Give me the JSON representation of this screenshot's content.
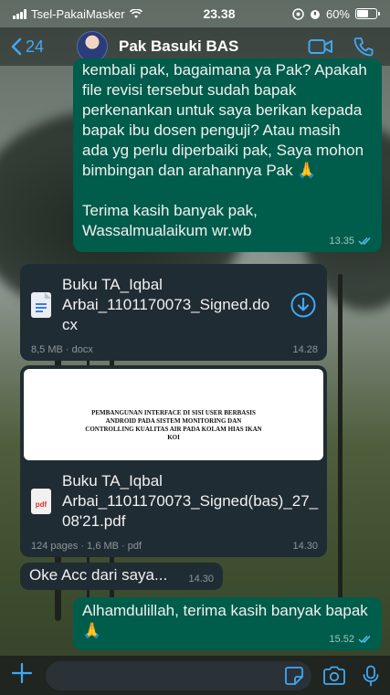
{
  "status_bar": {
    "carrier": "Tsel-PakaiMasker",
    "time": "23.38",
    "battery": "60%",
    "battery_level": 0.6
  },
  "header": {
    "back_count": "24",
    "contact_name": "Pak Basuki BAS",
    "icons": [
      "chevron-left-icon",
      "video-camera-icon",
      "phone-icon"
    ]
  },
  "messages": [
    {
      "direction": "outgoing",
      "lines": [
        "kembali pak, bagaimana ya Pak? Apakah",
        "file revisi tersebut sudah bapak",
        "perkenankan untuk saya berikan kepada",
        "bapak ibu dosen penguji? Atau masih",
        "ada yg perlu diperbaiki pak, Saya mohon",
        "bimbingan dan arahannya Pak 🙏",
        "",
        "Terima kasih banyak pak,",
        "Wassalmualaikum wr.wb"
      ],
      "time": "13.35"
    },
    {
      "direction": "incoming",
      "type": "document",
      "file_name_lines": [
        "Buku TA_Iqbal",
        "Arbai_1101170073_Signed.do",
        "cx"
      ],
      "info": "8,5 MB · docx",
      "time": "14.28"
    },
    {
      "direction": "incoming",
      "type": "pdf",
      "preview_lines": [
        "PEMBANGUNAN INTERFACE DI SISI USER BERBASIS",
        "ANDROID PADA SISTEM MONITORING DAN",
        "CONTROLLING KUALITAS AIR PADA KOLAM HIAS IKAN",
        "KOI"
      ],
      "file_name_lines": [
        "Buku TA_Iqbal",
        "Arbai_1101170073_Signed(bas)_27_",
        "08'21.pdf"
      ],
      "icon_label": "pdf",
      "info": "124 pages · 1,6 MB · pdf",
      "time": "14.30"
    },
    {
      "direction": "incoming",
      "text": "Oke Acc dari saya...",
      "time": "14.30"
    },
    {
      "direction": "outgoing",
      "lines": [
        "Alhamdulillah, terima kasih banyak bapak",
        "🙏"
      ],
      "time": "15.52"
    }
  ],
  "input_bar": {
    "icons": [
      "plus-icon",
      "sticker-icon",
      "camera-icon",
      "microphone-icon"
    ]
  },
  "colors": {
    "accent": "#3fa9f5",
    "outgoing_bubble": "#005c4b",
    "incoming_bubble": "#202c33",
    "read_ticks": "#53bdeb"
  }
}
